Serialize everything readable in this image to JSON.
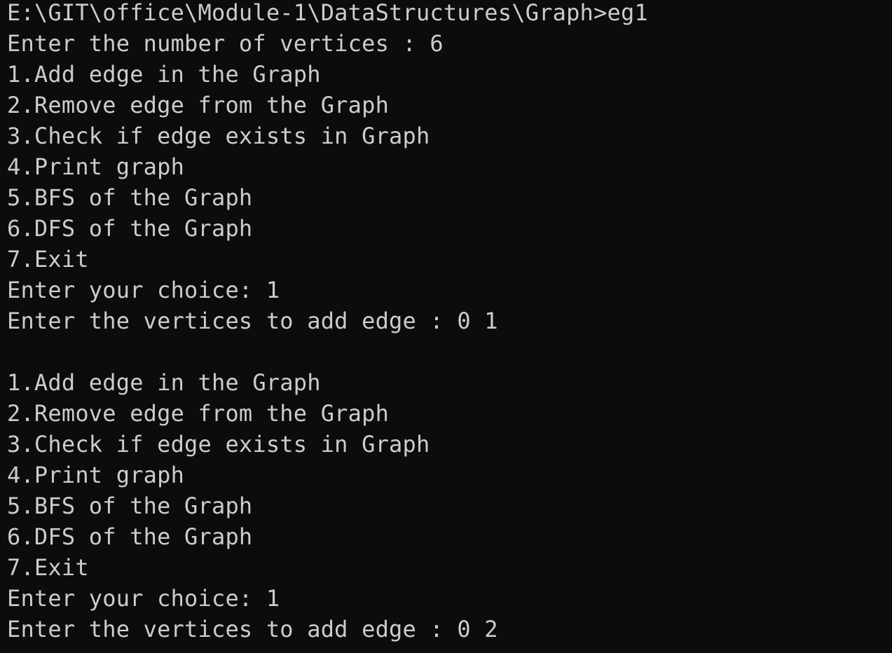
{
  "terminal": {
    "lines": [
      "E:\\GIT\\office\\Module-1\\DataStructures\\Graph>eg1",
      "Enter the number of vertices : 6",
      "1.Add edge in the Graph",
      "2.Remove edge from the Graph",
      "3.Check if edge exists in Graph",
      "4.Print graph",
      "5.BFS of the Graph",
      "6.DFS of the Graph",
      "7.Exit",
      "Enter your choice: 1",
      "Enter the vertices to add edge : 0 1",
      "",
      "1.Add edge in the Graph",
      "2.Remove edge from the Graph",
      "3.Check if edge exists in Graph",
      "4.Print graph",
      "5.BFS of the Graph",
      "6.DFS of the Graph",
      "7.Exit",
      "Enter your choice: 1",
      "Enter the vertices to add edge : 0 2"
    ]
  }
}
